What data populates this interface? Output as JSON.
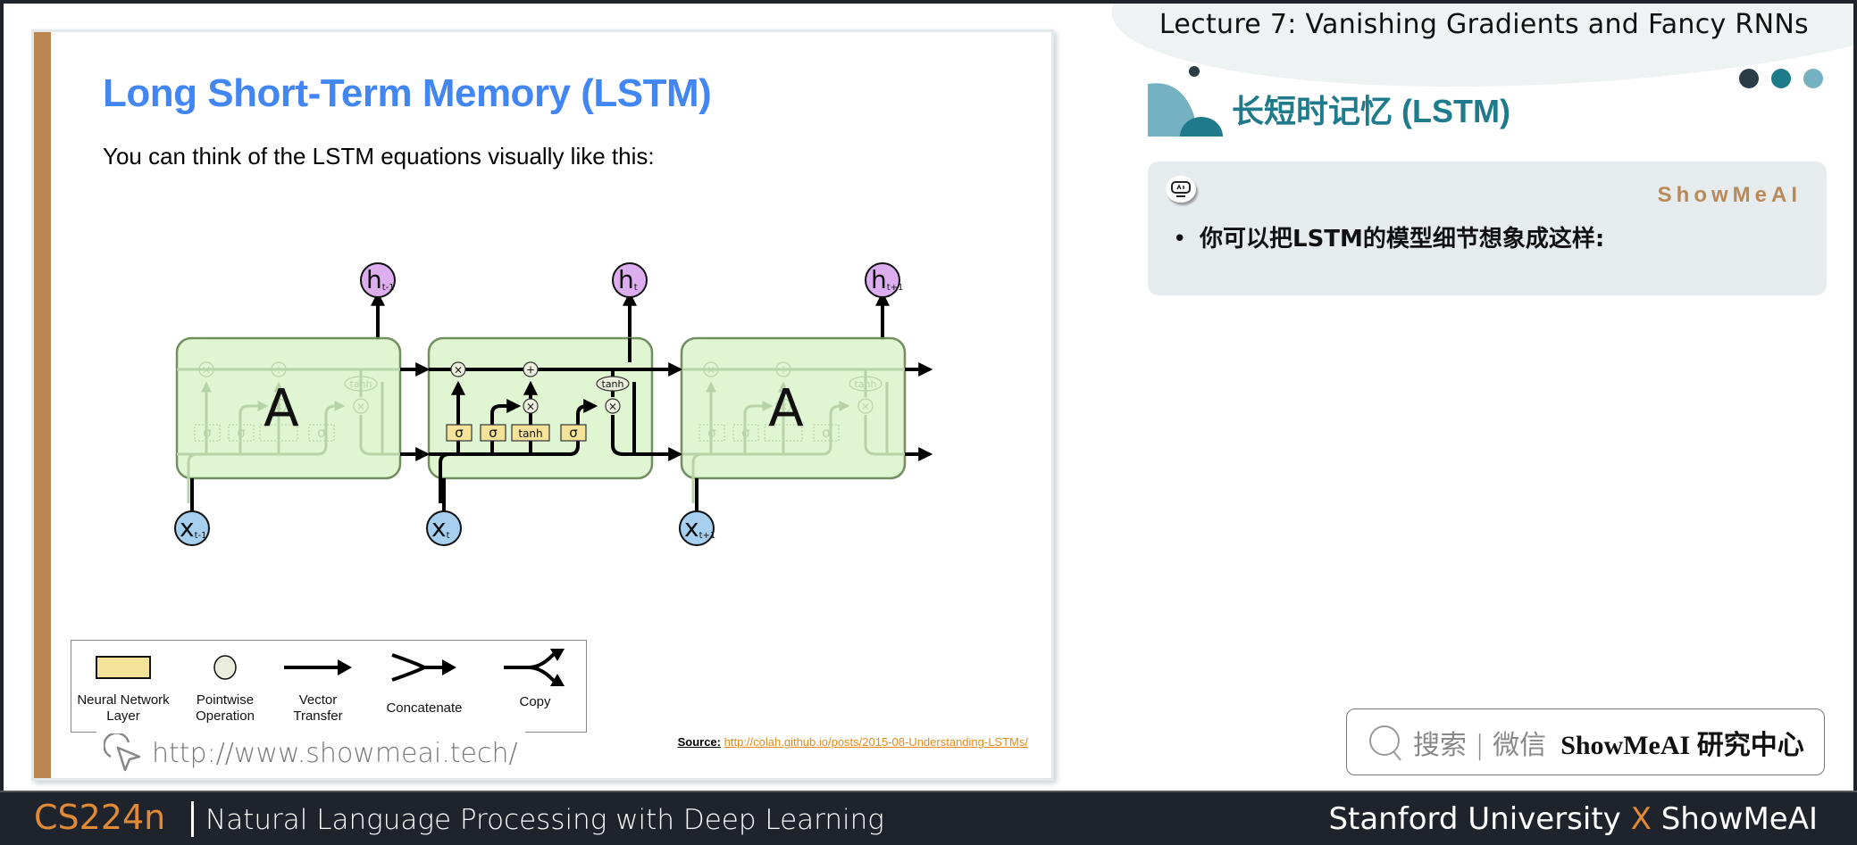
{
  "slide": {
    "title": "Long Short-Term Memory (LSTM)",
    "subtitle": "You can think of the LSTM equations visually like this:",
    "diagram": {
      "cells": [
        {
          "label": "A",
          "input": "x",
          "input_sub": "t-1",
          "output": "h",
          "output_sub": "t-1",
          "expanded": false
        },
        {
          "label": "",
          "input": "x",
          "input_sub": "t",
          "output": "h",
          "output_sub": "t",
          "expanded": true
        },
        {
          "label": "A",
          "input": "x",
          "input_sub": "t+1",
          "output": "h",
          "output_sub": "t+1",
          "expanded": false
        }
      ],
      "layers": [
        "σ",
        "σ",
        "tanh",
        "σ"
      ],
      "pointwise_ops": [
        "×",
        "+",
        "×",
        "×"
      ],
      "cell_state_activation": "tanh",
      "colors": {
        "cell": "#dff5cf",
        "cell_border": "#6b8a5a",
        "layer": "#f6e39a",
        "op": "#eceedd",
        "input": "#a6cff0",
        "output": "#dcaef0"
      }
    },
    "legend": [
      {
        "icon": "neural-network-layer-icon",
        "label": "Neural Network Layer"
      },
      {
        "icon": "pointwise-operation-icon",
        "label": "Pointwise Operation"
      },
      {
        "icon": "vector-transfer-icon",
        "label": "Vector Transfer"
      },
      {
        "icon": "concatenate-icon",
        "label": "Concatenate"
      },
      {
        "icon": "copy-icon",
        "label": "Copy"
      }
    ],
    "watermark": "http://www.showmeai.tech/",
    "source_label": "Source:",
    "source_url": "http://colah.github.io/posts/2015-08-Understanding-LSTMs/"
  },
  "right_panel": {
    "lecture_title": "Lecture 7:  Vanishing Gradients and Fancy RNNs",
    "section_title": "长短时记忆 (LSTM)",
    "dot_colors": [
      "#2b3c46",
      "#1f7a8c",
      "#74b2c2"
    ],
    "card": {
      "brand": "ShowMeAI",
      "bullet_text": "你可以把LSTM的模型细节想象成这样:"
    },
    "search": {
      "prefix": "搜索 | 微信",
      "name": "ShowMeAI 研究中心"
    }
  },
  "footer": {
    "course_code": "CS224n",
    "course_name": "Natural Language Processing with Deep Learning",
    "partner_left": "Stanford University",
    "partner_x": "X",
    "partner_right": "ShowMeAI"
  }
}
